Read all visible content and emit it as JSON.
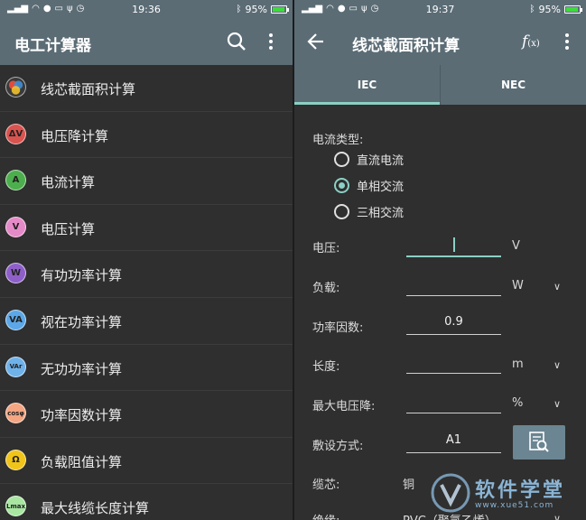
{
  "left": {
    "status": {
      "time": "19:36",
      "battery": "95%",
      "battery_level": 0.95
    },
    "title": "电工计算器",
    "menu": [
      {
        "label": "线芯截面积计算",
        "icon": "rgb-circles-icon",
        "badge": "",
        "color": "#d9d9d9"
      },
      {
        "label": "电压降计算",
        "icon": "voltage-drop-icon",
        "badge": "ΔV",
        "color": "#d9534f"
      },
      {
        "label": "电流计算",
        "icon": "current-icon",
        "badge": "A",
        "color": "#4cae4c"
      },
      {
        "label": "电压计算",
        "icon": "voltage-icon",
        "badge": "V",
        "color": "#e58ac8"
      },
      {
        "label": "有功功率计算",
        "icon": "active-power-icon",
        "badge": "W",
        "color": "#8e5fc9"
      },
      {
        "label": "视在功率计算",
        "icon": "apparent-power-icon",
        "badge": "VA",
        "color": "#5ba7e8"
      },
      {
        "label": "无功功率计算",
        "icon": "reactive-power-icon",
        "badge": "VAr",
        "color": "#6fb2ea"
      },
      {
        "label": "功率因数计算",
        "icon": "power-factor-icon",
        "badge": "cosφ",
        "color": "#f4a582"
      },
      {
        "label": "负载阻值计算",
        "icon": "resistance-icon",
        "badge": "Ω",
        "color": "#f0c419"
      },
      {
        "label": "最大线缆长度计算",
        "icon": "max-length-icon",
        "badge": "Lmax",
        "color": "#a8e6a1"
      }
    ]
  },
  "right": {
    "status": {
      "time": "19:37",
      "battery": "95%",
      "battery_level": 0.95
    },
    "title": "线芯截面积计算",
    "tabs": [
      "IEC",
      "NEC"
    ],
    "current_type_label": "电流类型:",
    "radios": [
      {
        "label": "直流电流",
        "selected": false
      },
      {
        "label": "单相交流",
        "selected": true
      },
      {
        "label": "三相交流",
        "selected": false
      }
    ],
    "fields": {
      "voltage": {
        "label": "电压:",
        "value": "",
        "unit": "V"
      },
      "load": {
        "label": "负载:",
        "value": "",
        "unit": "W"
      },
      "pf": {
        "label": "功率因数:",
        "value": "0.9",
        "unit": ""
      },
      "length": {
        "label": "长度:",
        "value": "",
        "unit": "m"
      },
      "maxdrop": {
        "label": "最大电压降:",
        "value": "",
        "unit": "%"
      },
      "install": {
        "label": "敷设方式:",
        "value": "A1",
        "unit": ""
      },
      "core": {
        "label": "缆芯:",
        "value": "铜",
        "unit": ""
      },
      "insul": {
        "label": "绝缘:",
        "value": "PVC（聚氯乙烯）",
        "unit": ""
      }
    },
    "watermark": {
      "text": "软件学堂",
      "url": "www.xue51.com"
    }
  },
  "colors": {
    "appbar": "#5b6c75",
    "accent": "#8bd0c4",
    "background": "#2f2f2f"
  }
}
